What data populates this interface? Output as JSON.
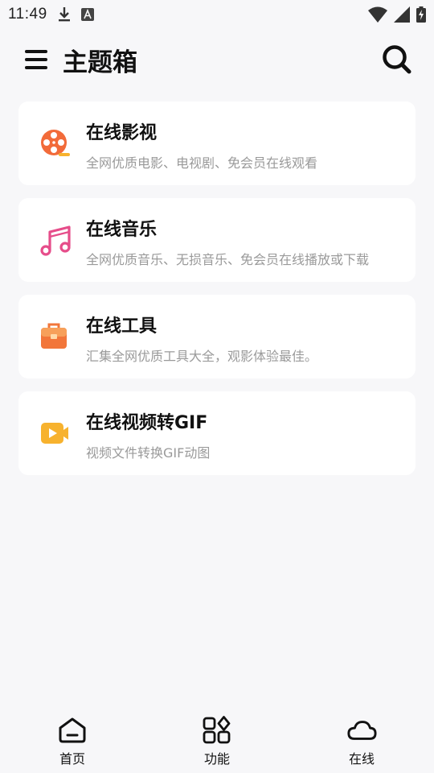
{
  "status_bar": {
    "time": "11:49",
    "icons": [
      "download-icon",
      "app-notification-icon",
      "wifi-icon",
      "signal-icon",
      "battery-charging-icon"
    ]
  },
  "app_bar": {
    "title": "主题箱",
    "menu_icon": "menu-icon",
    "search_icon": "search-icon"
  },
  "cards": [
    {
      "title": "在线影视",
      "desc": "全网优质电影、电视剧、免会员在线观看",
      "icon": "film-reel-icon",
      "color": "#f26b3a"
    },
    {
      "title": "在线音乐",
      "desc": "全网优质音乐、无损音乐、免会员在线播放或下载",
      "icon": "music-note-icon",
      "color": "#e64d8a"
    },
    {
      "title": "在线工具",
      "desc": "汇集全网优质工具大全，观影体验最佳。",
      "icon": "toolbox-icon",
      "color": "#f2763a"
    },
    {
      "title": "在线视频转GIF",
      "desc": "视频文件转换GIF动图",
      "icon": "video-camera-icon",
      "color": "#f7b22e"
    }
  ],
  "bottom_nav": [
    {
      "label": "首页",
      "icon": "home-icon"
    },
    {
      "label": "功能",
      "icon": "apps-grid-icon"
    },
    {
      "label": "在线",
      "icon": "cloud-icon"
    }
  ]
}
